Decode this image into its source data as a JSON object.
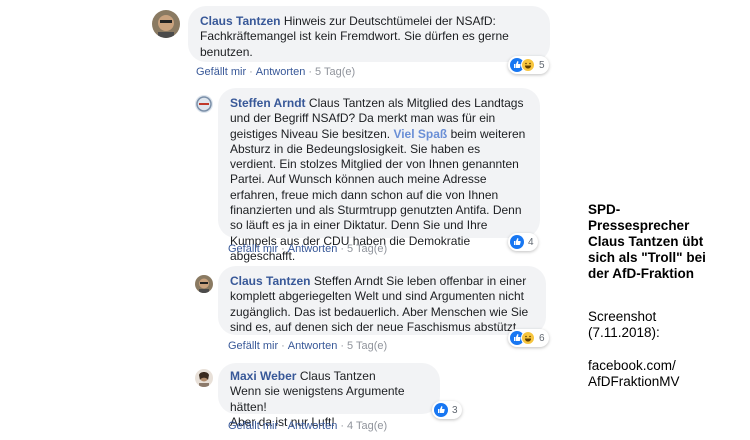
{
  "comments": [
    {
      "author": "Claus Tantzen",
      "text": "Hinweis zur Deutschtümelei der NSAfD: Fachkräftemangel ist kein Fremdwort. Sie dürfen es gerne benutzen.",
      "actions": {
        "like": "Gefällt mir",
        "reply": "Antworten",
        "time": "5 Tag(e)"
      },
      "reactions": {
        "count": "5",
        "types": [
          "like-icon",
          "haha-icon"
        ]
      }
    },
    {
      "author": "Steffen Arndt",
      "text_before_link": "Claus Tantzen als Mitglied des Landtags und der Begriff NSAfD? Da merkt man was für ein geistiges Niveau Sie besitzen.",
      "link_text": "Viel Spaß",
      "text_after_link": "beim weiteren Absturz in die Bedeungslosigkeit. Sie haben es verdient. Ein stolzes Mitglied der von Ihnen genannten Partei. Auf Wunsch können auch meine Adresse erfahren, freue mich dann schon auf die von Ihnen finanzierten und als Sturmtrupp genutzten Antifa. Denn so läuft es ja in einer Diktatur. Denn Sie und Ihre Kumpels aus der CDU haben die Demokratie abgeschafft.",
      "actions": {
        "like": "Gefällt mir",
        "reply": "Antworten",
        "time": "5 Tag(e)"
      },
      "reactions": {
        "count": "4",
        "types": [
          "like-icon"
        ]
      }
    },
    {
      "author": "Claus Tantzen",
      "text": "Steffen Arndt Sie leben offenbar in einer komplett abgeriegelten Welt und sind Argumenten nicht zugänglich. Das ist bedauerlich. Aber Menschen wie Sie sind es, auf denen sich der neue Faschismus abstützt.",
      "actions": {
        "like": "Gefällt mir",
        "reply": "Antworten",
        "time": "5 Tag(e)"
      },
      "reactions": {
        "count": "6",
        "types": [
          "like-icon",
          "haha-icon"
        ]
      }
    },
    {
      "author": "Maxi Weber",
      "text_line1": "Claus Tantzen",
      "text_line2": "Wenn sie wenigstens Argumente hätten!",
      "text_line3": "Aber da ist nur Luft!",
      "actions": {
        "like": "Gefällt mir",
        "reply": "Antworten",
        "time": "4 Tag(e)"
      },
      "reactions": {
        "count": "3",
        "types": [
          "like-icon"
        ]
      }
    }
  ],
  "sidebar": {
    "headline_lines": [
      "SPD-",
      "Pressesprecher",
      "Claus Tantzen übt",
      "sich als \"Troll\" bei",
      "der AfD-Fraktion"
    ],
    "caption_lines": [
      "Screenshot",
      "(7.11.2018):"
    ],
    "source_lines": [
      "facebook.com/",
      "AfDFraktionMV"
    ]
  },
  "colors": {
    "link": "#385898",
    "bubble": "#f2f3f5",
    "muted": "#90949c",
    "like": "#1877f2"
  }
}
